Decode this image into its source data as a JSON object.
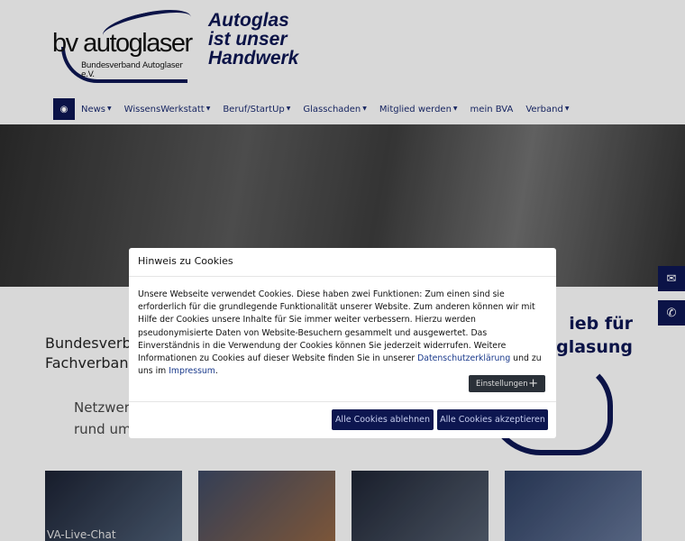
{
  "header": {
    "logo_main": "bv autoglaser",
    "logo_sub": "Bundesverband Autoglaser e.V.",
    "slogan": [
      "Autoglas",
      "ist unser",
      "Handwerk"
    ]
  },
  "nav": {
    "items": [
      {
        "label": "News",
        "dropdown": true
      },
      {
        "label": "WissensWerkstatt",
        "dropdown": true
      },
      {
        "label": "Beruf/StartUp",
        "dropdown": true
      },
      {
        "label": "Glasschaden",
        "dropdown": true
      },
      {
        "label": "Mitglied werden",
        "dropdown": true
      },
      {
        "label": "mein BVA",
        "dropdown": false
      },
      {
        "label": "Verband",
        "dropdown": true
      }
    ],
    "caret": "▼"
  },
  "side": {
    "mail_icon": "✉",
    "phone_icon": "✆"
  },
  "main": {
    "intro": [
      "Bundesverba",
      "Fachverband"
    ],
    "sub": [
      "Netzwerk",
      "rund um d"
    ],
    "promo": [
      "ieb für",
      "erglasung"
    ],
    "cards": [
      {
        "label": "VA-Live-Chat"
      },
      {
        "label": ""
      },
      {
        "label": ""
      },
      {
        "label": ""
      }
    ]
  },
  "cookie": {
    "title": "Hinweis zu Cookies",
    "text": "Unsere Webseite verwendet Cookies. Diese haben zwei Funktionen: Zum einen sind sie erforderlich für die grundlegende Funktionalität unserer Website. Zum anderen können wir mit Hilfe der Cookies unsere Inhalte für Sie immer weiter verbessern. Hierzu werden pseudonymisierte Daten von Website-Besuchern gesammelt und ausgewertet. Das Einverständnis in die Verwendung der Cookies können Sie jederzeit widerrufen. Weitere Informationen zu Cookies auf dieser Website finden Sie in unserer ",
    "privacy_link": "Datenschutzerklärung",
    "mid": " und zu uns im ",
    "imprint_link": "Impressum",
    "end": ".",
    "settings": "Einstellungen",
    "plus": "+",
    "reject": "Alle Cookies ablehnen",
    "accept": "Alle Cookies akzeptieren"
  },
  "colors": {
    "brand": "#0d1650"
  }
}
